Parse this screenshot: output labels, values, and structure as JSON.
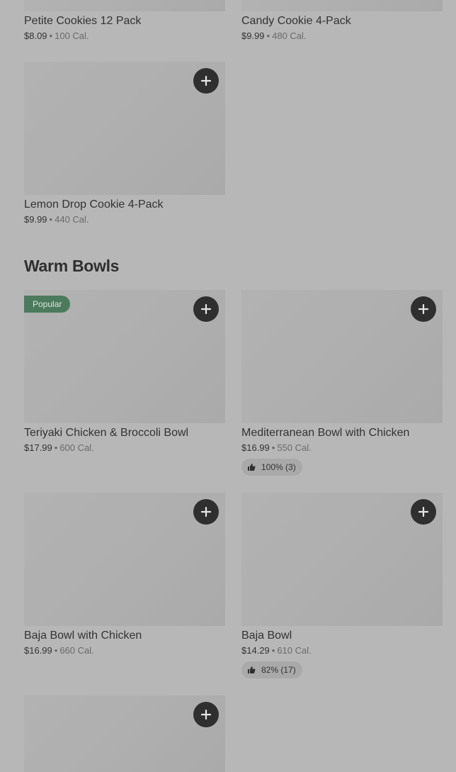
{
  "cookies": {
    "items": [
      {
        "name": "Petite Cookies 12 Pack",
        "price": "$8.09",
        "cal": "100 Cal."
      },
      {
        "name": "Candy Cookie 4-Pack",
        "price": "$9.99",
        "cal": "480 Cal."
      },
      {
        "name": "Lemon Drop Cookie 4-Pack",
        "price": "$9.99",
        "cal": "440 Cal."
      }
    ]
  },
  "warm_bowls": {
    "title": "Warm Bowls",
    "items": [
      {
        "name": "Teriyaki Chicken & Broccoli Bowl",
        "price": "$17.99",
        "cal": "600 Cal.",
        "badge": "Popular"
      },
      {
        "name": "Mediterranean Bowl with Chicken",
        "price": "$16.99",
        "cal": "550 Cal.",
        "rating": "100% (3)"
      },
      {
        "name": "Baja Bowl with Chicken",
        "price": "$16.99",
        "cal": "660 Cal."
      },
      {
        "name": "Baja Bowl",
        "price": "$14.29",
        "cal": "610 Cal.",
        "rating": "82% (17)"
      }
    ]
  },
  "separator": "•",
  "icons": {
    "add": "plus-icon",
    "rating": "thumbs-up-icon"
  },
  "colors": {
    "background": "#b7b7b7",
    "add_button": "#2f2f2f",
    "badge": "#4b7a5c"
  }
}
